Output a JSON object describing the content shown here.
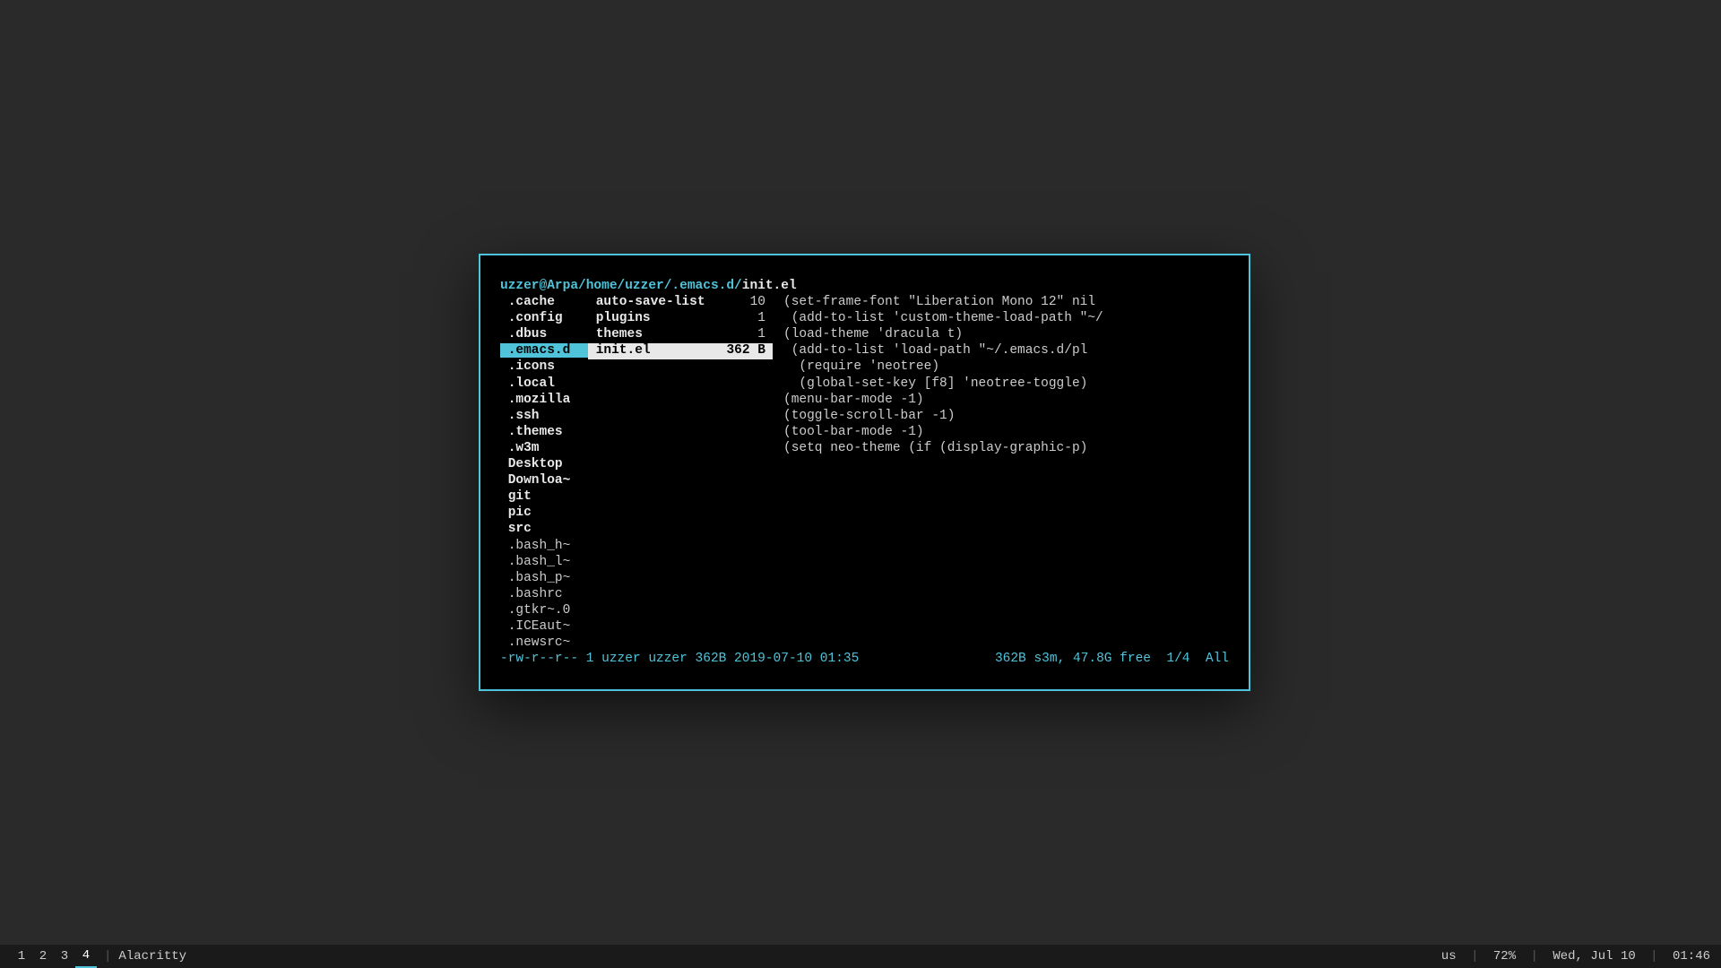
{
  "header": {
    "user_host": "uzzer@Arpa",
    "path": " /home/uzzer/.emacs.d/",
    "file": "init.el"
  },
  "left": [
    ".cache",
    ".config",
    ".dbus",
    ".emacs.d",
    ".icons",
    ".local",
    ".mozilla",
    ".ssh",
    ".themes",
    ".w3m",
    "Desktop",
    "Downloa~",
    "git",
    "pic",
    "src",
    ".bash_h~",
    ".bash_l~",
    ".bash_p~",
    ".bashrc",
    ".gtkr~.0",
    ".ICEaut~",
    ".newsrc~"
  ],
  "left_dir_flags": [
    true,
    true,
    true,
    true,
    true,
    true,
    true,
    true,
    true,
    true,
    true,
    true,
    true,
    true,
    true,
    false,
    false,
    false,
    false,
    false,
    false,
    false
  ],
  "left_selected_index": 3,
  "mid": [
    {
      "name": "auto-save-list",
      "size": "10"
    },
    {
      "name": "plugins",
      "size": "1"
    },
    {
      "name": "themes",
      "size": "1"
    },
    {
      "name": "init.el",
      "size": "362 B"
    }
  ],
  "mid_selected_index": 3,
  "code": [
    "(set-frame-font \"Liberation Mono 12\" nil",
    " (add-to-list 'custom-theme-load-path \"~/",
    "(load-theme 'dracula t)",
    " (add-to-list 'load-path \"~/.emacs.d/pl",
    "  (require 'neotree)",
    "  (global-set-key [f8] 'neotree-toggle)",
    "(menu-bar-mode -1)",
    "(toggle-scroll-bar -1)",
    "(tool-bar-mode -1)",
    "(setq neo-theme (if (display-graphic-p)"
  ],
  "status": {
    "left": "-rw-r--r-- 1 uzzer uzzer 362B 2019-07-10 01:35",
    "right": "362B s3m, 47.8G free  1/4  All"
  },
  "taskbar": {
    "workspaces": [
      "1",
      "2",
      "3",
      "4"
    ],
    "active_workspace_index": 3,
    "app": "Alacritty",
    "kb_layout": "us",
    "battery": "72%",
    "date": "Wed, Jul 10",
    "time": "01:46",
    "sep": " | "
  }
}
